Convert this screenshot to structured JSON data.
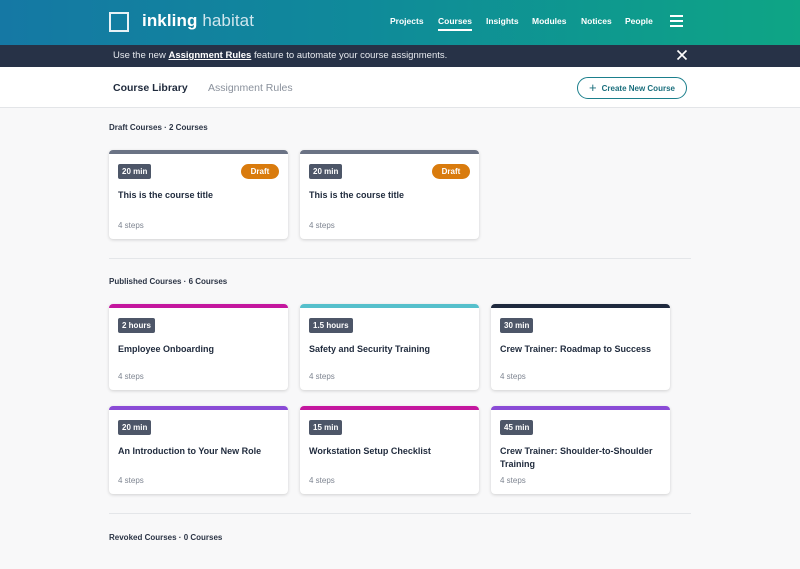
{
  "app": {
    "name_bold": "inkling",
    "name_light": "habitat"
  },
  "nav": {
    "items": [
      {
        "label": "Projects",
        "active": false
      },
      {
        "label": "Courses",
        "active": true
      },
      {
        "label": "Insights",
        "active": false
      },
      {
        "label": "Modules",
        "active": false
      },
      {
        "label": "Notices",
        "active": false
      },
      {
        "label": "People",
        "active": false
      }
    ],
    "menu_icon": "hamburger-icon"
  },
  "banner": {
    "prefix": "Use the new ",
    "link": "Assignment Rules",
    "suffix": " feature to automate your course assignments.",
    "close_icon": "close-icon"
  },
  "subheader": {
    "tabs": [
      {
        "label": "Course Library",
        "active": true
      },
      {
        "label": "Assignment Rules",
        "active": false
      }
    ],
    "create_button": "Create New Course",
    "create_icon": "plus-icon"
  },
  "sections": {
    "draft": {
      "title": "Draft Courses · 2 Courses",
      "cards": [
        {
          "duration": "20 min",
          "badge": "Draft",
          "title": "This is the course title",
          "steps": "4 steps",
          "color": "#6b7385"
        },
        {
          "duration": "20 min",
          "badge": "Draft",
          "title": "This is the course title",
          "steps": "4 steps",
          "color": "#6b7385"
        }
      ]
    },
    "published": {
      "title": "Published Courses · 6 Courses",
      "cards": [
        {
          "duration": "2 hours",
          "title": "Employee Onboarding",
          "steps": "4 steps",
          "color": "#c4179e"
        },
        {
          "duration": "1.5 hours",
          "title": "Safety and Security Training",
          "steps": "4 steps",
          "color": "#56c0cc"
        },
        {
          "duration": "30 min",
          "title": "Crew Trainer: Roadmap to Success",
          "steps": "4 steps",
          "color": "#1f2a3e"
        },
        {
          "duration": "20 min",
          "title": "An Introduction to Your New Role",
          "steps": "4 steps",
          "color": "#8a4bd6"
        },
        {
          "duration": "15 min",
          "title": "Workstation Setup Checklist",
          "steps": "4 steps",
          "color": "#c4179e"
        },
        {
          "duration": "45 min",
          "title": "Crew Trainer:  Shoulder-to-Shoulder Training",
          "steps": "4 steps",
          "color": "#8a4bd6"
        }
      ]
    },
    "revoked": {
      "title": "Revoked Courses · 0 Courses"
    }
  },
  "colors": {
    "draft_badge": "#d97b0d",
    "accent": "#1b7f8c",
    "banner": "#273247"
  }
}
